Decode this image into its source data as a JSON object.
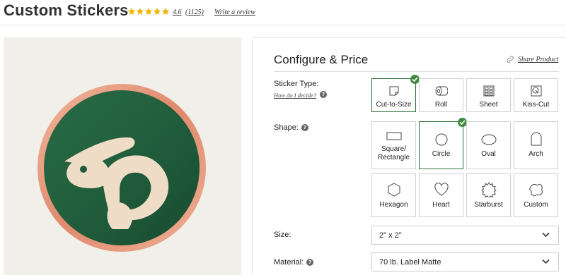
{
  "header": {
    "title": "Custom Stickers",
    "rating": "4.6",
    "review_count": "(1125)",
    "write_review": "Write a review",
    "star_color": "#f0b400",
    "stars_filled": 5
  },
  "product": {
    "image_icon": "rabbit-logo-sticker",
    "colors": {
      "background": "#f1efea",
      "ring": "#e2987c",
      "disc": "#1f5b3a",
      "figure": "#efdcc6"
    }
  },
  "configurator": {
    "title": "Configure & Price",
    "share_label": "Share Product",
    "accent_color": "#3f8a40",
    "sticker_type": {
      "label": "Sticker Type:",
      "help_link": "How do I decide?",
      "options": [
        {
          "label": "Cut-to-Size",
          "icon": "cut-to-size-icon",
          "selected": true
        },
        {
          "label": "Roll",
          "icon": "roll-icon",
          "selected": false
        },
        {
          "label": "Sheet",
          "icon": "sheet-icon",
          "selected": false
        },
        {
          "label": "Kiss-Cut",
          "icon": "kiss-cut-icon",
          "selected": false
        }
      ]
    },
    "shape": {
      "label": "Shape:",
      "options": [
        {
          "label": "Square/ Rectangle",
          "icon": "rectangle-icon",
          "selected": false
        },
        {
          "label": "Circle",
          "icon": "circle-icon",
          "selected": true
        },
        {
          "label": "Oval",
          "icon": "oval-icon",
          "selected": false
        },
        {
          "label": "Arch",
          "icon": "arch-icon",
          "selected": false
        },
        {
          "label": "Hexagon",
          "icon": "hexagon-icon",
          "selected": false
        },
        {
          "label": "Heart",
          "icon": "heart-icon",
          "selected": false
        },
        {
          "label": "Starburst",
          "icon": "starburst-icon",
          "selected": false
        },
        {
          "label": "Custom",
          "icon": "custom-shape-icon",
          "selected": false
        }
      ]
    },
    "size": {
      "label": "Size:",
      "value": "2\" x 2\""
    },
    "material": {
      "label": "Material:",
      "value": "70 lb. Label Matte"
    }
  }
}
